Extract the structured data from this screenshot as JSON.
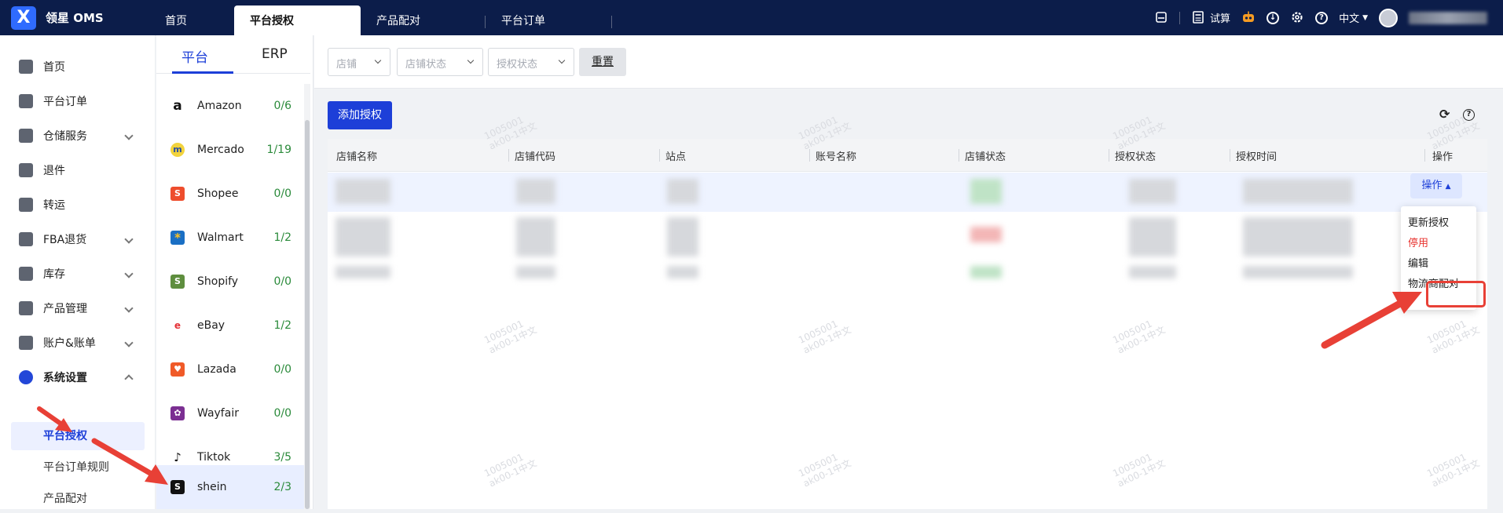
{
  "header": {
    "logo_glyph": "X",
    "brand": "领星 OMS",
    "tabs": [
      {
        "label": "首页"
      },
      {
        "label": "平台授权"
      },
      {
        "label": "产品配对"
      },
      {
        "label": "平台订单"
      }
    ],
    "trial_label": "试算",
    "language": "中文",
    "brand_color": "#0c1d4a",
    "accent_color": "#1d3fd8"
  },
  "sidebar": {
    "items": [
      {
        "label": "首页",
        "icon": "home-icon"
      },
      {
        "label": "平台订单",
        "icon": "order-icon"
      },
      {
        "label": "仓储服务",
        "icon": "warehouse-icon"
      },
      {
        "label": "退件",
        "icon": "return-icon"
      },
      {
        "label": "转运",
        "icon": "transfer-icon"
      },
      {
        "label": "FBA退货",
        "icon": "fba-icon"
      },
      {
        "label": "库存",
        "icon": "inventory-icon"
      },
      {
        "label": "产品管理",
        "icon": "product-icon"
      },
      {
        "label": "账户&账单",
        "icon": "account-icon"
      },
      {
        "label": "系统设置",
        "icon": "settings-icon"
      }
    ],
    "sub_items": [
      {
        "label": "平台授权"
      },
      {
        "label": "平台订单规则"
      },
      {
        "label": "产品配对"
      }
    ]
  },
  "platform_panel": {
    "tabs": [
      {
        "label": "平台"
      },
      {
        "label": "ERP"
      }
    ],
    "platforms": [
      {
        "name": "Amazon",
        "count": "0/6",
        "logo": "a",
        "color": "#ffffff"
      },
      {
        "name": "Mercado",
        "count": "1/19",
        "logo": "m",
        "color": "#f2d33d"
      },
      {
        "name": "Shopee",
        "count": "0/0",
        "logo": "S",
        "color": "#ee4d2d"
      },
      {
        "name": "Walmart",
        "count": "1/2",
        "logo": "*",
        "color": "#1a6fc4"
      },
      {
        "name": "Shopify",
        "count": "0/0",
        "logo": "S",
        "color": "#5e8e3e"
      },
      {
        "name": "eBay",
        "count": "1/2",
        "logo": "e",
        "color": "#ffffff"
      },
      {
        "name": "Lazada",
        "count": "0/0",
        "logo": "♥",
        "color": "#f05a28"
      },
      {
        "name": "Wayfair",
        "count": "0/0",
        "logo": "✿",
        "color": "#7b2f92"
      },
      {
        "name": "Tiktok",
        "count": "3/5",
        "logo": "♪",
        "color": "#ffffff"
      },
      {
        "name": "shein",
        "count": "2/3",
        "logo": "S",
        "color": "#111111"
      }
    ]
  },
  "filters": {
    "store_placeholder": "店铺",
    "store_status_placeholder": "店铺状态",
    "auth_status_placeholder": "授权状态",
    "reset_label": "重置"
  },
  "main": {
    "add_button": "添加授权",
    "columns": [
      "店铺名称",
      "店铺代码",
      "站点",
      "账号名称",
      "店铺状态",
      "授权状态",
      "授权时间",
      "操作"
    ],
    "row_action_label": "操作",
    "action_menu": [
      {
        "label": "更新授权"
      },
      {
        "label": "停用"
      },
      {
        "label": "编辑"
      },
      {
        "label": "物流商配对"
      }
    ],
    "watermark_lines": [
      "1005001",
      "ak00-1中文"
    ]
  }
}
